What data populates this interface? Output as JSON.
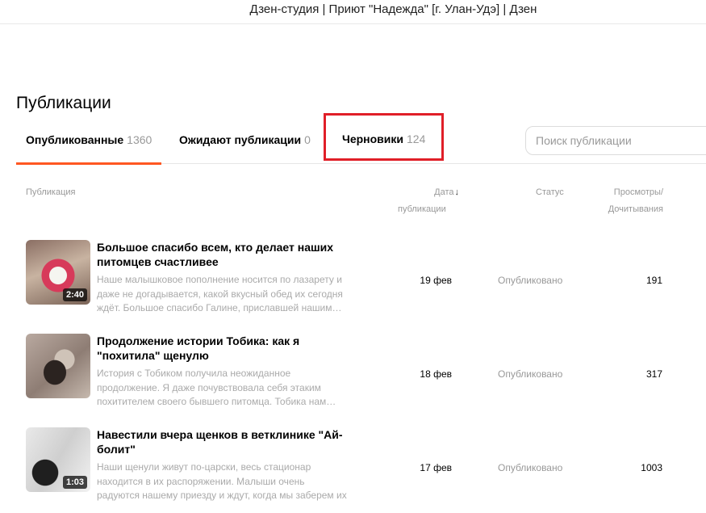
{
  "window": {
    "title": "Дзен-студия | Приют \"Надежда\" [г. Улан-Удэ] | Дзен"
  },
  "page": {
    "title": "Публикации"
  },
  "tabs": [
    {
      "label": "Опубликованные",
      "count": "1360"
    },
    {
      "label": "Ожидают публикации",
      "count": "0"
    },
    {
      "label": "Черновики",
      "count": "124"
    }
  ],
  "search": {
    "placeholder": "Поиск публикации",
    "value": ""
  },
  "table": {
    "headers": {
      "publication": "Публикация",
      "date_line1": "Дата",
      "date_arrow": "↓",
      "date_line2": "публикации",
      "status": "Статус",
      "views_line1": "Просмотры/",
      "views_line2": "Дочитывания"
    },
    "rows": [
      {
        "duration": "2:40",
        "title": "Большое спасибо всем, кто делает наших питомцев счастливее",
        "description": "Наше малышковое пополнение носится по лазарету и даже не догадывается, какой вкусный обед их сегодня ждёт. Большое спасибо Галине, приславшей нашим…",
        "date": "19 фев",
        "status": "Опубликовано",
        "views": "191"
      },
      {
        "duration": "",
        "title": "Продолжение истории Тобика: как я \"похитила\" щенулю",
        "description": "История с Тобиком получила неожиданное продолжение. Я даже почувствовала себя этаким похитителем своего бывшего питомца. Тобика нам…",
        "date": "18 фев",
        "status": "Опубликовано",
        "views": "317"
      },
      {
        "duration": "1:03",
        "title": "Навестили вчера щенков в ветклинике \"Ай-болит\"",
        "description": "Наши щенули живут по-царски, весь стационар находится в их распоряжении. Малыши очень радуются нашему приезду и ждут, когда мы заберем их в приют.…",
        "date": "17 фев",
        "status": "Опубликовано",
        "views": "1003"
      }
    ]
  }
}
